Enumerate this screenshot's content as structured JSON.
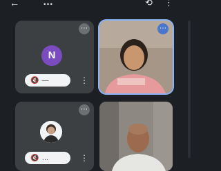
{
  "topbar": {
    "title": "…",
    "back_glyph": "←",
    "icons": [
      "switch-camera-icon",
      "more-icon"
    ]
  },
  "tiles": [
    {
      "kind": "avatar-initial",
      "initial": "N",
      "avatar_color": "#7b4bbf",
      "more_glyph": "⋯",
      "controls": {
        "mic": "🔇",
        "extra": "—"
      }
    },
    {
      "kind": "video",
      "more_glyph": "⋯",
      "selected": true
    },
    {
      "kind": "avatar-photo",
      "more_glyph": "⋯",
      "controls": {
        "mic": "🔇",
        "extra": "…"
      }
    },
    {
      "kind": "video"
    }
  ],
  "colors": {
    "background": "#1c1f24",
    "tile": "#3c4043",
    "accent": "#8ab4f8"
  }
}
